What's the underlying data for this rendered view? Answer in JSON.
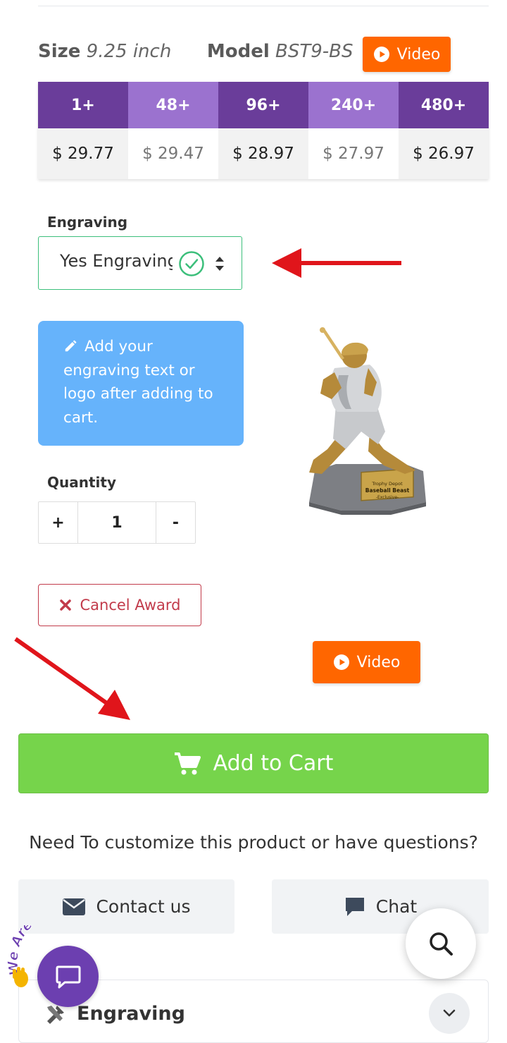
{
  "spec": {
    "size_label": "Size",
    "size_value": "9.25 inch",
    "model_label": "Model",
    "model_value": "BST9-BS",
    "video_label": "Video"
  },
  "price_table": {
    "tiers": [
      "1+",
      "48+",
      "96+",
      "240+",
      "480+"
    ],
    "prices": [
      "$ 29.77",
      "$ 29.47",
      "$ 28.97",
      "$ 27.97",
      "$ 26.97"
    ]
  },
  "engraving": {
    "label": "Engraving",
    "selected": "Yes Engraving"
  },
  "info_box": {
    "lines": [
      "Add your",
      "engraving text or",
      "logo after adding to",
      "cart."
    ]
  },
  "quantity": {
    "label": "Quantity",
    "plus": "+",
    "value": "1",
    "minus": "-"
  },
  "cancel_label": "Cancel Award",
  "video2_label": "Video",
  "product_image": {
    "plaque_line1": "Trophy Depot",
    "plaque_line2": "Baseball Beast",
    "plaque_line3": "-Exclusive-"
  },
  "add_to_cart_label": "Add to Cart",
  "question_text": "Need To customize this product or have questions?",
  "contact_label": "Contact us",
  "chat_label": "Chat",
  "accordion_title": "Engraving",
  "we_are_here": "We Are Here!",
  "colors": {
    "purple_dark": "#6a3d9a",
    "purple_light": "#9b72cf",
    "orange": "#ff6600",
    "green": "#76d44b",
    "info_blue": "#66b3fb",
    "cancel_red": "#c23b4b"
  }
}
